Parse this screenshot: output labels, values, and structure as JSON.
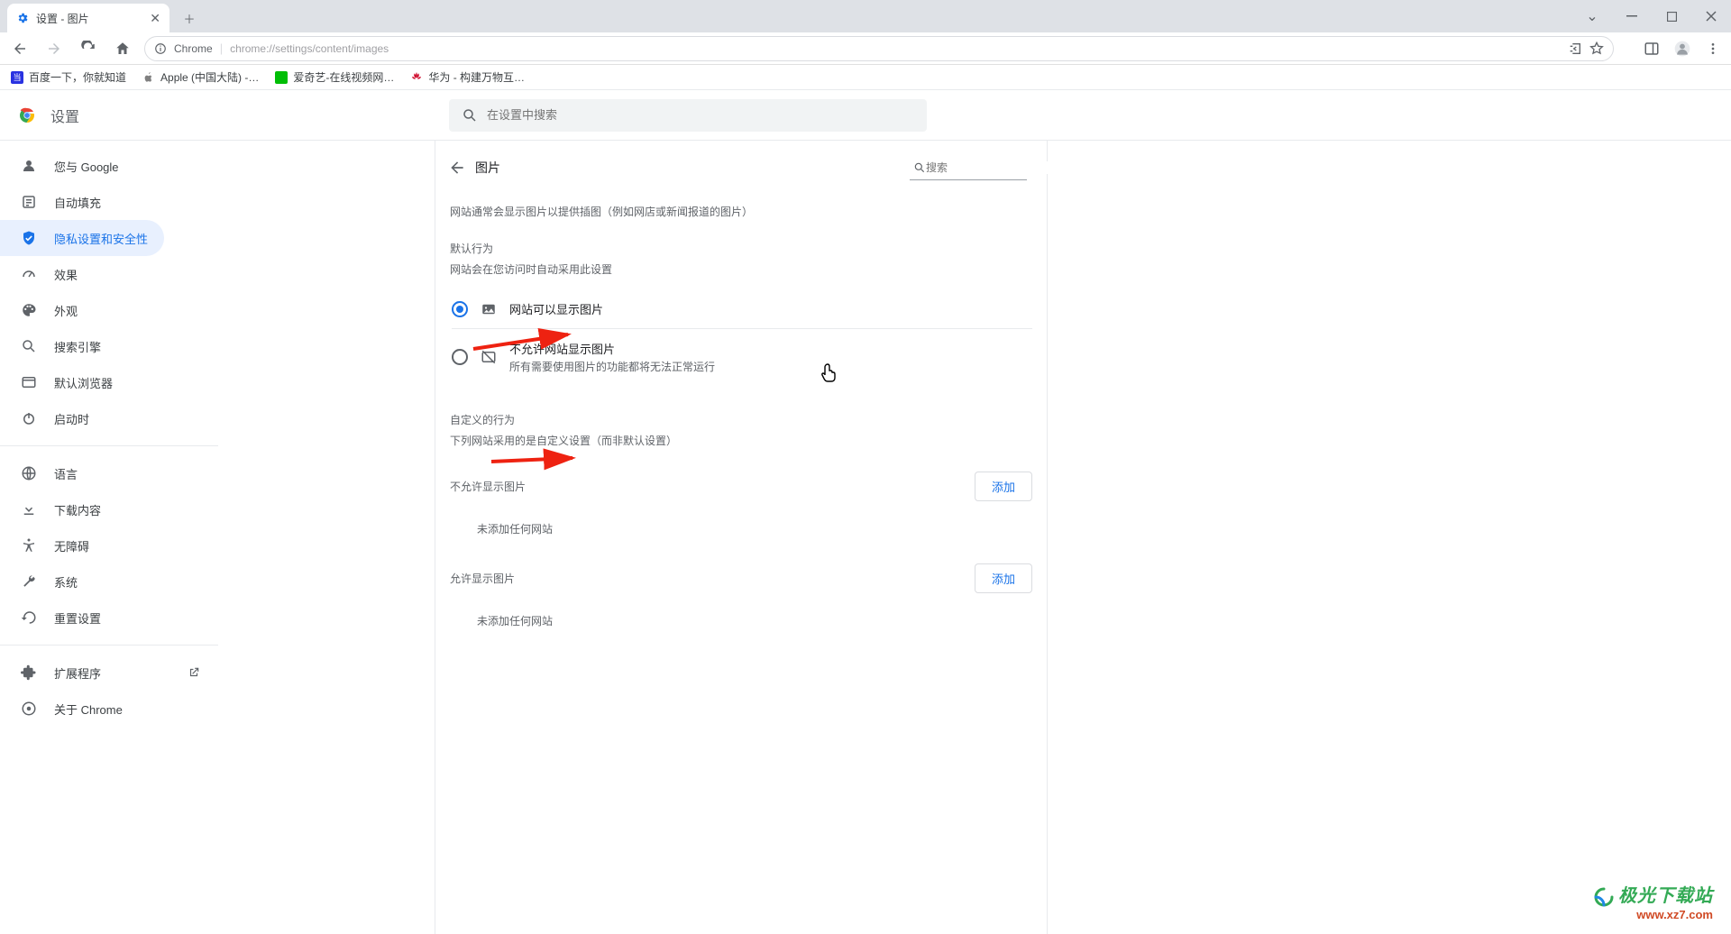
{
  "tab": {
    "title": "设置 - 图片"
  },
  "address": {
    "scheme_label": "Chrome",
    "url": "chrome://settings/content/images"
  },
  "bookmarks": [
    {
      "label": "百度一下，你就知道",
      "icon_color": "#2932e1"
    },
    {
      "label": "Apple (中国大陆) -…",
      "icon_color": "#808080"
    },
    {
      "label": "爱奇艺-在线视频网…",
      "icon_color": "#00be06"
    },
    {
      "label": "华为 - 构建万物互…",
      "icon_color": "#cf0a2c"
    }
  ],
  "header": {
    "title": "设置",
    "search_placeholder": "在设置中搜索"
  },
  "sidebar": {
    "items": [
      {
        "key": "you",
        "label": "您与 Google"
      },
      {
        "key": "autofill",
        "label": "自动填充"
      },
      {
        "key": "privacy",
        "label": "隐私设置和安全性",
        "active": true
      },
      {
        "key": "perf",
        "label": "效果"
      },
      {
        "key": "appearance",
        "label": "外观"
      },
      {
        "key": "search",
        "label": "搜索引擎"
      },
      {
        "key": "default",
        "label": "默认浏览器"
      },
      {
        "key": "startup",
        "label": "启动时"
      }
    ],
    "items2": [
      {
        "key": "lang",
        "label": "语言"
      },
      {
        "key": "downloads",
        "label": "下载内容"
      },
      {
        "key": "a11y",
        "label": "无障碍"
      },
      {
        "key": "system",
        "label": "系统"
      },
      {
        "key": "reset",
        "label": "重置设置"
      }
    ],
    "items3": [
      {
        "key": "ext",
        "label": "扩展程序"
      },
      {
        "key": "about",
        "label": "关于 Chrome"
      }
    ]
  },
  "page": {
    "title": "图片",
    "search_placeholder": "搜索",
    "description": "网站通常会显示图片以提供插图（例如网店或新闻报道的图片）",
    "default_heading": "默认行为",
    "default_sub": "网站会在您访问时自动采用此设置",
    "option_allow": "网站可以显示图片",
    "option_block": "不允许网站显示图片",
    "option_block_sub": "所有需要使用图片的功能都将无法正常运行",
    "custom_heading": "自定义的行为",
    "custom_sub": "下列网站采用的是自定义设置（而非默认设置）",
    "block_list_label": "不允许显示图片",
    "allow_list_label": "允许显示图片",
    "add_button": "添加",
    "empty_text": "未添加任何网站"
  },
  "watermark": {
    "line1": "极光下载站",
    "line2": "www.xz7.com"
  }
}
